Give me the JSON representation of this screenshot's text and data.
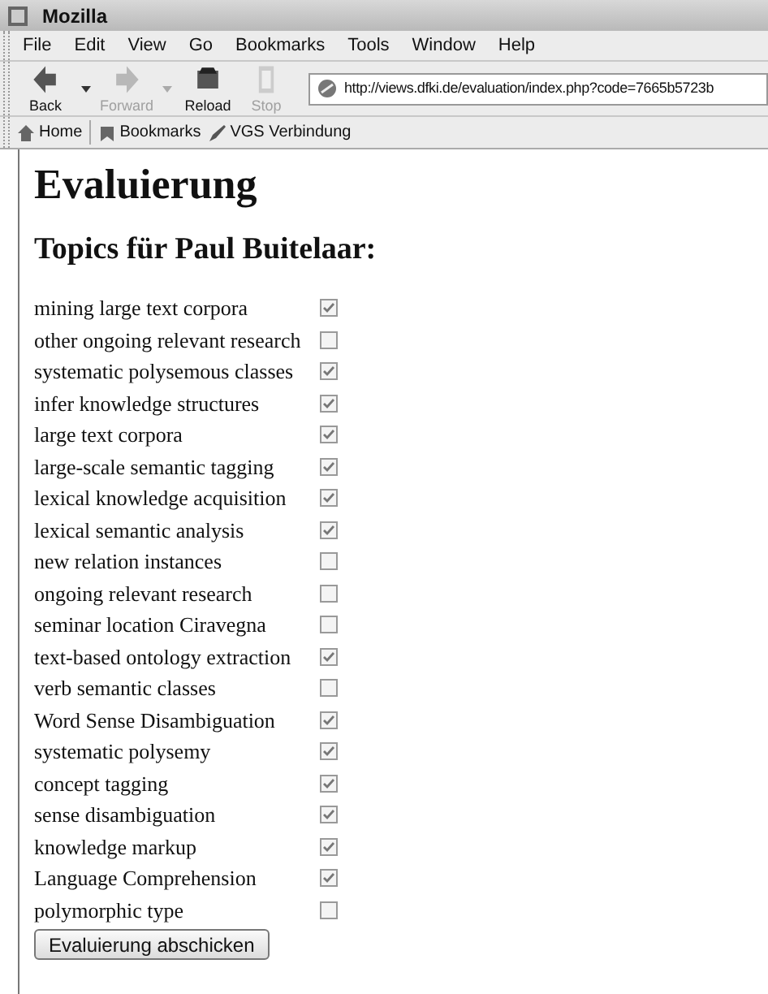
{
  "window": {
    "title": "Mozilla"
  },
  "menu": [
    "File",
    "Edit",
    "View",
    "Go",
    "Bookmarks",
    "Tools",
    "Window",
    "Help"
  ],
  "toolbar": [
    {
      "label": "Back",
      "disabled": false,
      "dropdown": true
    },
    {
      "label": "Forward",
      "disabled": true,
      "dropdown": true
    },
    {
      "label": "Reload",
      "disabled": false,
      "dropdown": false
    },
    {
      "label": "Stop",
      "disabled": true,
      "dropdown": false
    }
  ],
  "address": {
    "value": "http://views.dfki.de/evaluation/index.php?code=7665b5723b"
  },
  "bookmarks": [
    "Home",
    "Bookmarks",
    "VGS Verbindung"
  ],
  "page": {
    "heading": "Evaluierung",
    "subheading": "Topics für Paul Buitelaar:",
    "topics": [
      {
        "label": "mining large text corpora",
        "checked": true
      },
      {
        "label": "other ongoing relevant research",
        "checked": false
      },
      {
        "label": "systematic polysemous classes",
        "checked": true
      },
      {
        "label": "infer knowledge structures",
        "checked": true
      },
      {
        "label": "large text corpora",
        "checked": true
      },
      {
        "label": "large-scale semantic tagging",
        "checked": true
      },
      {
        "label": "lexical knowledge acquisition",
        "checked": true
      },
      {
        "label": "lexical semantic analysis",
        "checked": true
      },
      {
        "label": "new relation instances",
        "checked": false
      },
      {
        "label": "ongoing relevant research",
        "checked": false
      },
      {
        "label": "seminar location Ciravegna",
        "checked": false
      },
      {
        "label": "text-based ontology extraction",
        "checked": true
      },
      {
        "label": "verb semantic classes",
        "checked": false
      },
      {
        "label": "Word Sense Disambiguation",
        "checked": true
      },
      {
        "label": "systematic polysemy",
        "checked": true
      },
      {
        "label": "concept tagging",
        "checked": true
      },
      {
        "label": "sense disambiguation",
        "checked": true
      },
      {
        "label": "knowledge markup",
        "checked": true
      },
      {
        "label": "Language Comprehension",
        "checked": true
      },
      {
        "label": "polymorphic type",
        "checked": false
      }
    ],
    "submit": "Evaluierung abschicken"
  }
}
